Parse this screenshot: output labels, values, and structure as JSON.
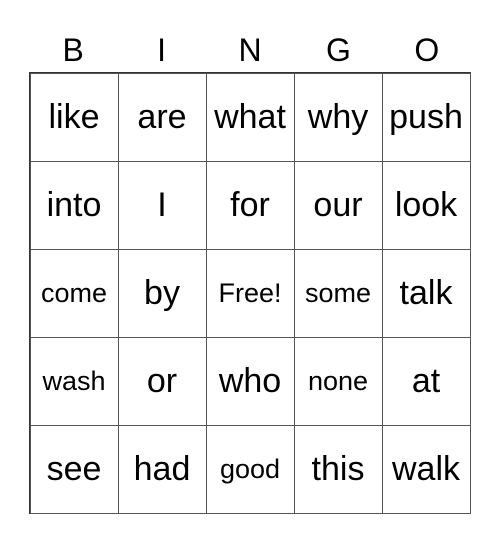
{
  "header": [
    "B",
    "I",
    "N",
    "G",
    "O"
  ],
  "cells": [
    [
      "like",
      "are",
      "what",
      "why",
      "push"
    ],
    [
      "into",
      "I",
      "for",
      "our",
      "look"
    ],
    [
      "come",
      "by",
      "Free!",
      "some",
      "talk"
    ],
    [
      "wash",
      "or",
      "who",
      "none",
      "at"
    ],
    [
      "see",
      "had",
      "good",
      "this",
      "walk"
    ]
  ],
  "free_space": "Free!"
}
